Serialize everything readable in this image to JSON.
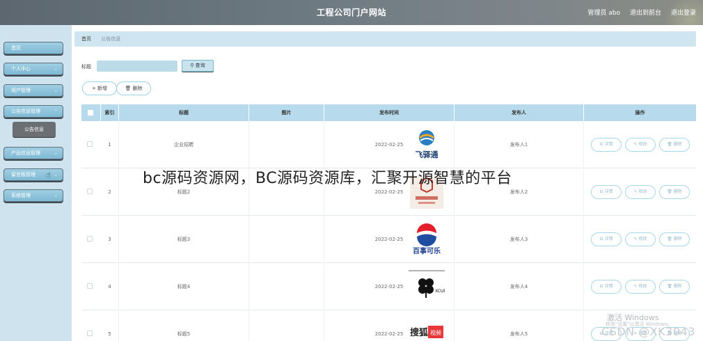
{
  "header": {
    "title": "工程公司门户网站",
    "admin_label": "管理员 abo",
    "back_label": "退出到前台",
    "logout_label": "退出登录"
  },
  "sidebar": {
    "items": [
      {
        "label": "首页",
        "has_chevron": false
      },
      {
        "label": "个人中心",
        "has_chevron": true
      },
      {
        "label": "用户管理",
        "has_chevron": true
      },
      {
        "label": "公告信息管理",
        "has_chevron": true
      },
      {
        "label": "产品信息管理",
        "has_chevron": true
      },
      {
        "label": "留言板管理",
        "has_chevron": true
      },
      {
        "label": "系统管理",
        "has_chevron": true
      }
    ],
    "sub_item": "公告信息"
  },
  "breadcrumb": {
    "home": "首页",
    "current": "公告信息"
  },
  "search": {
    "label": "标题",
    "button": "查询",
    "value": ""
  },
  "actions": {
    "add": "新增",
    "delete": "删除"
  },
  "table": {
    "columns": [
      "索引",
      "标题",
      "图片",
      "发布时间",
      "发布人",
      "操作"
    ],
    "rows": [
      {
        "index": "1",
        "title": "企业招聘",
        "date": "2022-02-25",
        "publisher": "发布人1",
        "logo": "logo-blue-icon"
      },
      {
        "index": "2",
        "title": "标题2",
        "date": "2022-02-25",
        "publisher": "发布人2",
        "logo": "logo-red-icon"
      },
      {
        "index": "3",
        "title": "标题3",
        "date": "2022-02-25",
        "publisher": "发布人3",
        "logo": "pepsi-logo-icon"
      },
      {
        "index": "4",
        "title": "标题4",
        "date": "2022-02-25",
        "publisher": "发布人4",
        "logo": "clover-logo-icon"
      },
      {
        "index": "5",
        "title": "标题5",
        "date": "2022-02-25",
        "publisher": "发布人5",
        "logo": "video-logo-icon"
      }
    ],
    "ops": {
      "detail": "详情",
      "edit": "修改",
      "delete": "删除"
    }
  },
  "overlay": {
    "watermark": "bc源码资源网，BC源码资源库，汇聚开源智慧的平台",
    "win_title": "激活 Windows",
    "win_sub": "转到\"设置\"以激活 Windows。",
    "csdn": "CSDN @XK3043"
  }
}
